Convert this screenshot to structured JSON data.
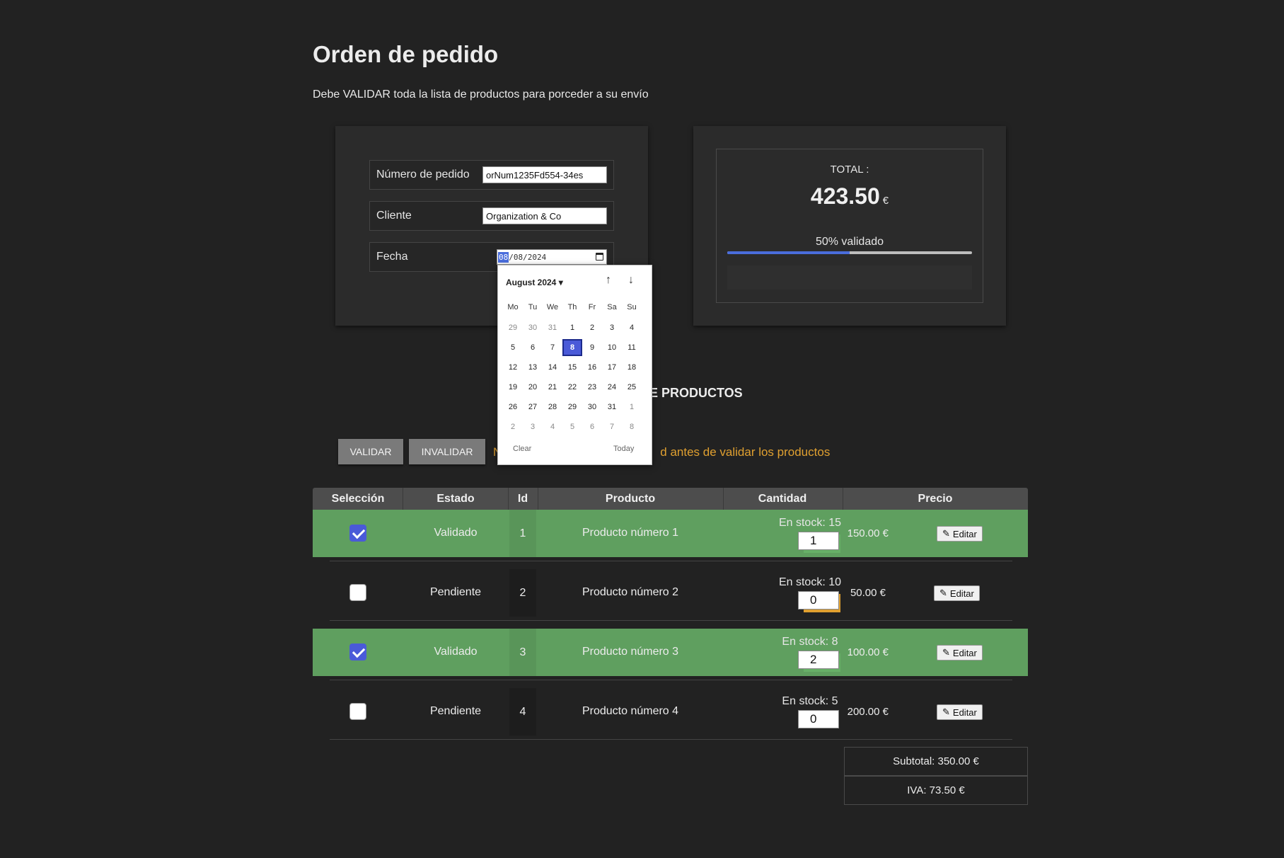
{
  "page": {
    "title": "Orden de pedido",
    "subtitle": "Debe VALIDAR toda la lista de productos para porceder a su envío"
  },
  "form": {
    "order_label": "Número de pedido",
    "order_value": "orNum1235Fd554-34es",
    "client_label": "Cliente",
    "client_value": "Organization & Co",
    "date_label": "Fecha",
    "date_day": "08",
    "date_rest": "/08/2024"
  },
  "total": {
    "label": "TOTAL :",
    "value": "423.50",
    "currency": "€",
    "progress_label": "50% validado",
    "progress_fraction": 0.5
  },
  "products_heading": "E PRODUCTOS",
  "actions": {
    "validate_label": "VALIDAR",
    "invalidate_label": "INVALIDAR",
    "warning_lead": "N",
    "warning_text": "d antes de validar los productos"
  },
  "table": {
    "headers": [
      "Selección",
      "Estado",
      "Id",
      "Producto",
      "Cantidad",
      "Precio"
    ],
    "rows": [
      {
        "checked": true,
        "status": "Validado",
        "id": "1",
        "product": "Producto número 1",
        "stock": "En stock: 15",
        "qty": "1",
        "price": "150.00 €",
        "edit": "Editar",
        "qty_color": "#67b067"
      },
      {
        "checked": false,
        "status": "Pendiente",
        "id": "2",
        "product": "Producto número 2",
        "stock": "En stock: 10",
        "qty": "0",
        "price": "50.00 €",
        "edit": "Editar",
        "qty_color": "#e0a030"
      },
      {
        "checked": true,
        "status": "Validado",
        "id": "3",
        "product": "Producto número 3",
        "stock": "En stock: 8",
        "qty": "2",
        "price": "100.00 €",
        "edit": "Editar",
        "qty_color": "#67b067"
      },
      {
        "checked": false,
        "status": "Pendiente",
        "id": "4",
        "product": "Producto número 4",
        "stock": "En stock: 5",
        "qty": "0",
        "price": "200.00 €",
        "edit": "Editar",
        "qty_color": ""
      }
    ],
    "subtotal": "Subtotal: 350.00 €",
    "iva": "IVA: 73.50 €"
  },
  "calendar": {
    "month_label": "August 2024 ▾",
    "up_arrow": "↑",
    "down_arrow": "↓",
    "weekdays": [
      "Mo",
      "Tu",
      "We",
      "Th",
      "Fr",
      "Sa",
      "Su"
    ],
    "weeks": [
      [
        "29",
        "30",
        "31",
        "1",
        "2",
        "3",
        "4"
      ],
      [
        "5",
        "6",
        "7",
        "8",
        "9",
        "10",
        "11"
      ],
      [
        "12",
        "13",
        "14",
        "15",
        "16",
        "17",
        "18"
      ],
      [
        "19",
        "20",
        "21",
        "22",
        "23",
        "24",
        "25"
      ],
      [
        "26",
        "27",
        "28",
        "29",
        "30",
        "31",
        "1"
      ],
      [
        "2",
        "3",
        "4",
        "5",
        "6",
        "7",
        "8"
      ]
    ],
    "selected": "8",
    "clear_label": "Clear",
    "today_label": "Today"
  },
  "colors": {
    "accent": "#4a5ad8",
    "valid_row": "#5f9f5f",
    "warning": "#e0a030"
  }
}
